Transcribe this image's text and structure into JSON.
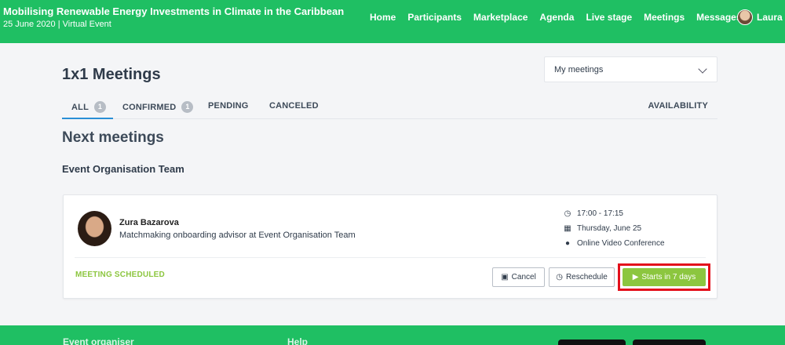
{
  "header": {
    "event_title": "Mobilising Renewable Energy Investments in Climate in the Caribbean",
    "event_subtitle": "25 June 2020 | Virtual Event",
    "nav": [
      "Home",
      "Participants",
      "Marketplace",
      "Agenda",
      "Live stage",
      "Meetings",
      "Messages"
    ],
    "user_name": "Laura"
  },
  "page": {
    "title": "1x1 Meetings",
    "filter": {
      "selected": "My meetings"
    }
  },
  "tabs": {
    "all": {
      "label": "ALL",
      "count": "1"
    },
    "confirmed": {
      "label": "CONFIRMED",
      "count": "1"
    },
    "pending": {
      "label": "PENDING"
    },
    "canceled": {
      "label": "CANCELED"
    },
    "availability": {
      "label": "AVAILABILITY"
    }
  },
  "section_title": "Next meetings",
  "group_title": "Event Organisation Team",
  "meeting": {
    "person_name": "Zura Bazarova",
    "person_role": "Matchmaking onboarding advisor at Event Organisation Team",
    "time": "17:00 - 17:15",
    "date": "Thursday, June 25",
    "location": "Online Video Conference",
    "status": "MEETING SCHEDULED",
    "cancel_label": "Cancel",
    "reschedule_label": "Reschedule",
    "start_label": "Starts in 7 days"
  },
  "footer": {
    "organiser_heading": "Event organiser",
    "help_heading": "Help"
  },
  "colors": {
    "brand_green": "#1fbf63",
    "status_green": "#8cc63f",
    "highlight_red": "#e3101b",
    "tab_underline": "#2a8fd6"
  }
}
